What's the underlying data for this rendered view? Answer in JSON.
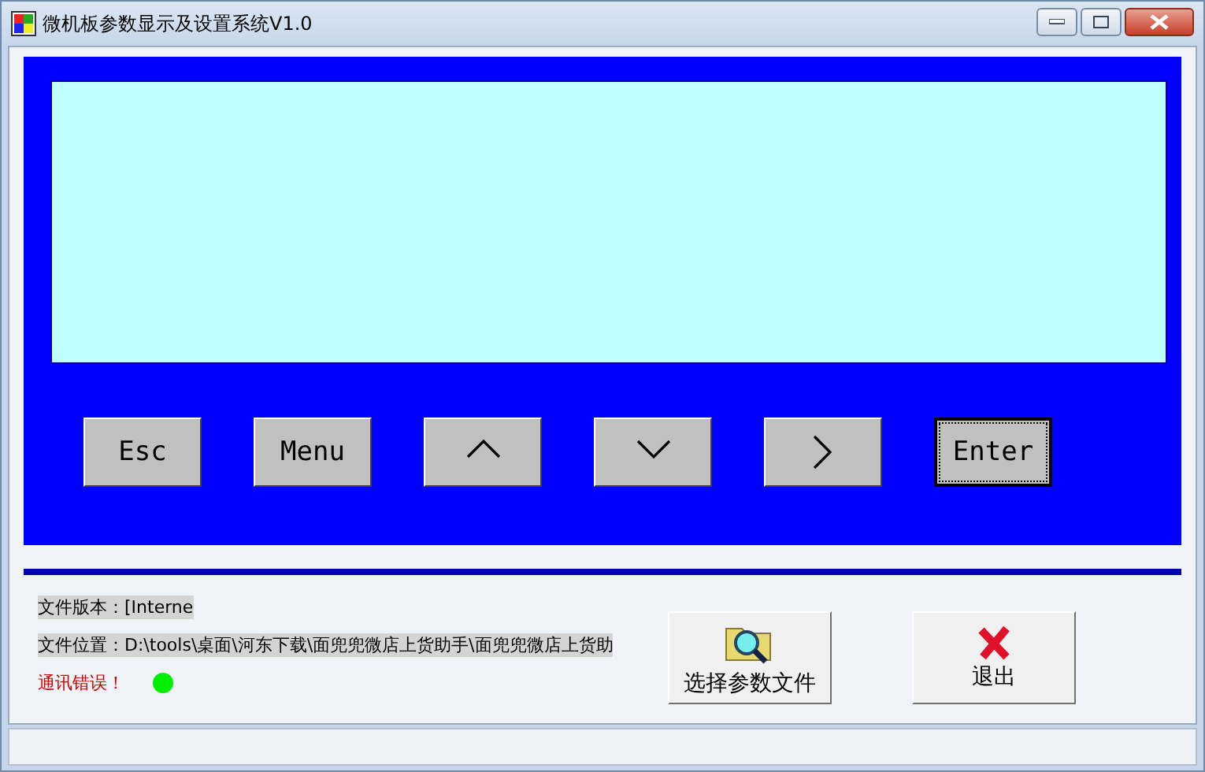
{
  "window": {
    "title": "微机板参数显示及设置系统V1.0"
  },
  "keys": [
    {
      "kind": "text",
      "label": "Esc",
      "focused": false
    },
    {
      "kind": "text",
      "label": "Menu",
      "focused": false
    },
    {
      "kind": "up",
      "focused": false
    },
    {
      "kind": "down",
      "focused": false
    },
    {
      "kind": "right",
      "focused": false
    },
    {
      "kind": "text",
      "label": "Enter",
      "focused": true
    }
  ],
  "info": {
    "version_label": "文件版本：",
    "version_value": "[Interne",
    "location_label": "文件位置：",
    "location_value": "D:\\tools\\桌面\\河东下载\\面兜兜微店上货助手\\面兜兜微店上货助",
    "error": "通讯错误！",
    "status_dot": {
      "color": "#00ee00"
    }
  },
  "buttons": [
    {
      "kind": "open",
      "label": "选择参数文件"
    },
    {
      "kind": "exit",
      "label": "退出"
    }
  ]
}
